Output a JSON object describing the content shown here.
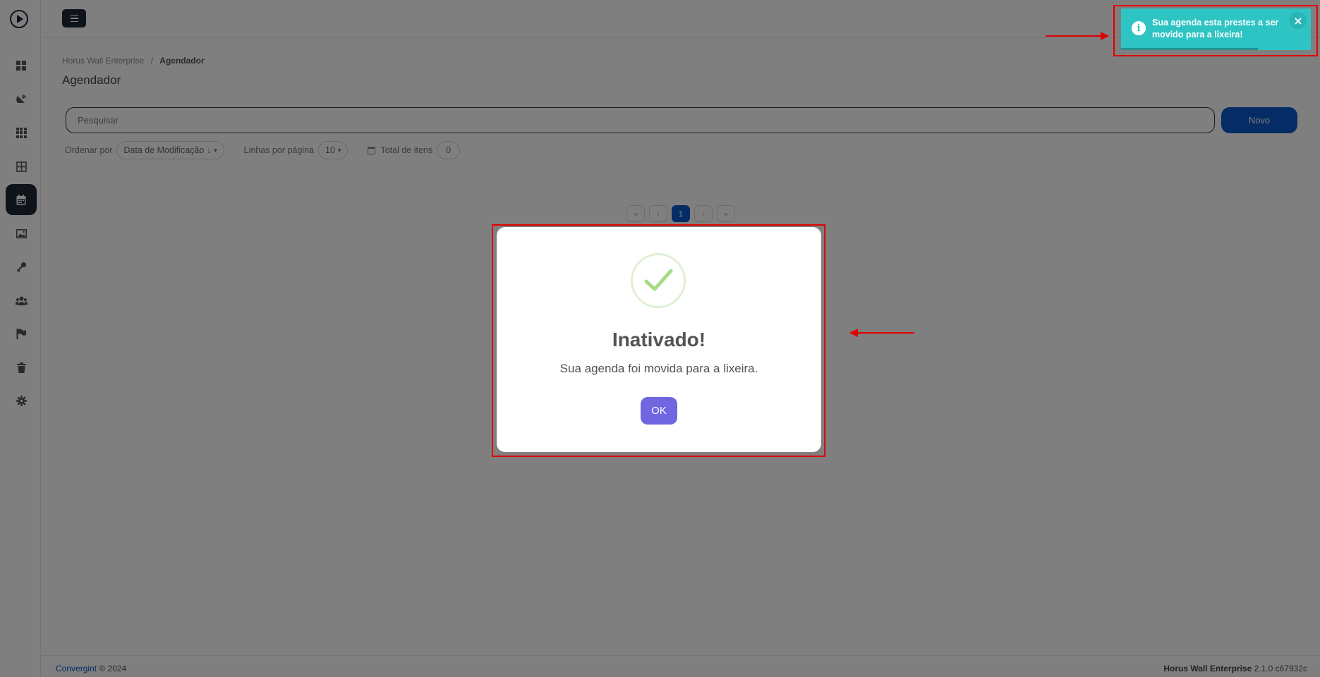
{
  "sidebar": {
    "items": [
      {
        "name": "dashboard",
        "icon": "dashboard-icon",
        "active": false
      },
      {
        "name": "broadcast",
        "icon": "satellite-dish-icon",
        "active": false
      },
      {
        "name": "grid",
        "icon": "grid-icon",
        "active": false
      },
      {
        "name": "layout",
        "icon": "layout-icon",
        "active": false
      },
      {
        "name": "scheduler",
        "icon": "calendar-icon",
        "active": true
      },
      {
        "name": "media",
        "icon": "image-icon",
        "active": false
      },
      {
        "name": "keys",
        "icon": "key-icon",
        "active": false
      },
      {
        "name": "users",
        "icon": "users-icon",
        "active": false
      },
      {
        "name": "flags",
        "icon": "flag-icon",
        "active": false
      },
      {
        "name": "trash",
        "icon": "trash-icon",
        "active": false
      },
      {
        "name": "settings",
        "icon": "gear-icon",
        "active": false
      }
    ]
  },
  "breadcrumb": {
    "root": "Horus Wall Enterprise",
    "separator": "/",
    "current": "Agendador"
  },
  "page": {
    "title": "Agendador"
  },
  "search": {
    "placeholder": "Pesquisar",
    "value": ""
  },
  "toolbar": {
    "new_label": "Novo"
  },
  "filters": {
    "sort_label": "Ordenar por",
    "sort_value": "Data de Modificação ↓",
    "rows_label": "Linhas por página",
    "rows_value": "10",
    "total_label": "Total de itens",
    "total_value": "0"
  },
  "pagination": {
    "first": "«",
    "prev": "‹",
    "current": "1",
    "next": "›",
    "last": "»"
  },
  "modal": {
    "title": "Inativado!",
    "text": "Sua agenda foi movida para a lixeira.",
    "ok_label": "OK",
    "icon": "success-check-icon"
  },
  "toast": {
    "message": "Sua agenda esta prestes a ser movido para a lixeira!",
    "close": "×",
    "icon": "info-icon",
    "color": "#2ec4c4",
    "progress": 0.72
  },
  "footer": {
    "brand": "Convergint",
    "copyright": "© 2024",
    "product": "Horus Wall Enterprise",
    "version": "2.1.0 c67932c"
  },
  "colors": {
    "primary": "#0a58ca",
    "dark": "#1f2937",
    "confirm": "#7066e0",
    "annotation": "#e00000"
  }
}
